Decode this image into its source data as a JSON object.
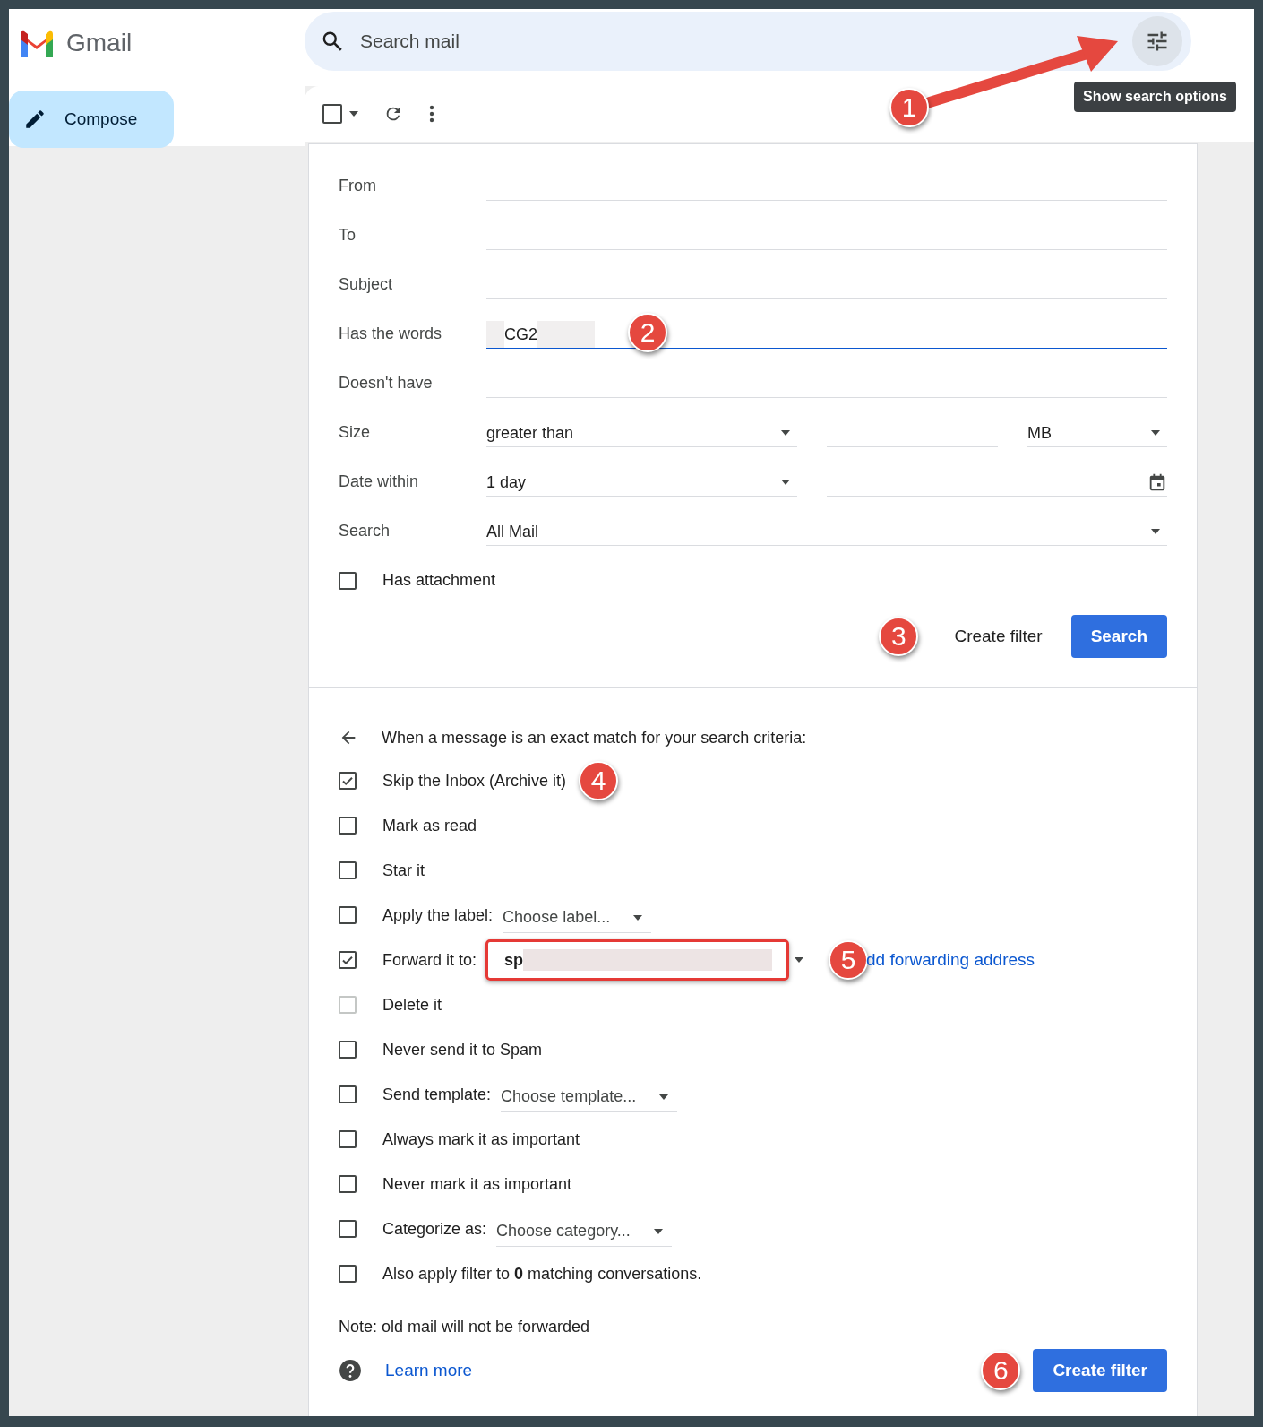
{
  "app": {
    "name": "Gmail"
  },
  "compose": {
    "label": "Compose"
  },
  "toolbar": {
    "select_all": {
      "checked": false
    }
  },
  "search": {
    "placeholder": "Search mail",
    "options_tooltip": "Show search options",
    "callout": "1"
  },
  "criteria": [
    {
      "label": "From",
      "kind": "text",
      "focused": false
    },
    {
      "label": "To",
      "kind": "text",
      "focused": false
    },
    {
      "label": "Subject",
      "kind": "text",
      "focused": false
    },
    {
      "label": "Has the words",
      "kind": "text",
      "value": "CG2",
      "focused": true,
      "callout": "2"
    },
    {
      "label": "Doesn't have",
      "kind": "text",
      "focused": false
    },
    {
      "label": "Size",
      "kind": "size",
      "operator": "greater than",
      "unit": "MB"
    },
    {
      "label": "Date within",
      "kind": "date",
      "range": "1 day"
    },
    {
      "label": "Search",
      "kind": "select",
      "value": "All Mail"
    }
  ],
  "has_attachment": {
    "label": "Has attachment",
    "checked": false
  },
  "search_actions": {
    "create_filter": "Create filter",
    "search": "Search",
    "callout": "3"
  },
  "filter_actions": {
    "intro": "When a message is an exact match for your search criteria:",
    "items": [
      {
        "kind": "plain",
        "label": "Skip the Inbox (Archive it)",
        "checked": true,
        "disabled": false,
        "callout": "4"
      },
      {
        "kind": "plain",
        "label": "Mark as read",
        "checked": false,
        "disabled": false
      },
      {
        "kind": "plain",
        "label": "Star it",
        "checked": false,
        "disabled": false
      },
      {
        "kind": "select",
        "label": "Apply the label:",
        "value": "Choose label...",
        "checked": false,
        "disabled": false
      },
      {
        "kind": "forward",
        "label": "Forward it to:",
        "value": "sp",
        "link": "dd forwarding address",
        "checked": true,
        "disabled": false,
        "callout": "5"
      },
      {
        "kind": "plain",
        "label": "Delete it",
        "checked": false,
        "disabled": true
      },
      {
        "kind": "plain",
        "label": "Never send it to Spam",
        "checked": false,
        "disabled": false
      },
      {
        "kind": "select",
        "label": "Send template:",
        "value": "Choose template...",
        "checked": false,
        "disabled": false
      },
      {
        "kind": "plain",
        "label": "Always mark it as important",
        "checked": false,
        "disabled": false
      },
      {
        "kind": "plain",
        "label": "Never mark it as important",
        "checked": false,
        "disabled": false
      },
      {
        "kind": "select",
        "label": "Categorize as:",
        "value": "Choose category...",
        "checked": false,
        "disabled": false
      },
      {
        "kind": "plain",
        "label": "Also apply filter to **0** matching conversations.",
        "checked": false,
        "disabled": false
      }
    ]
  },
  "footer": {
    "note": "Note: old mail will not be forwarded",
    "learn_more": "Learn more",
    "create_filter": "Create filter",
    "callout": "6"
  }
}
